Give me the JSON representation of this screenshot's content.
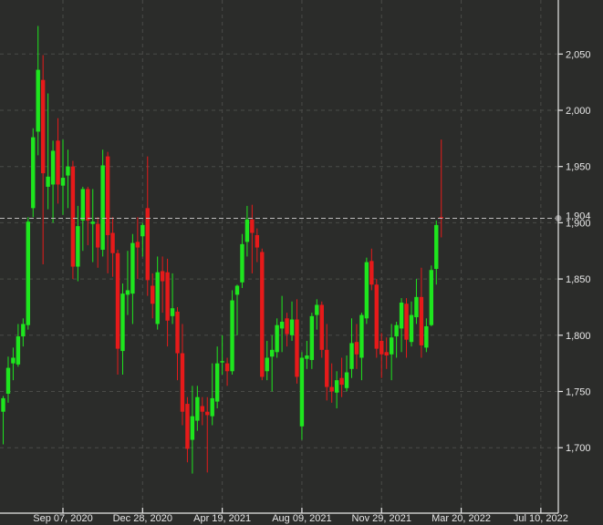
{
  "chart_data": {
    "type": "candlestick",
    "title": "",
    "xlabel": "",
    "ylabel": "",
    "interval": "weekly",
    "start_week": "2020-06-15",
    "ylim": [
      1640,
      2095
    ],
    "grid": true,
    "y_ticks": [
      1700,
      1750,
      1800,
      1850,
      1900,
      1950,
      2000,
      2050
    ],
    "y_tick_labels": [
      "1,700",
      "1,750",
      "1,800",
      "1,850",
      "1,900",
      "1,950",
      "2,000",
      "2,050"
    ],
    "x_ticks_week_index": [
      12,
      28,
      44,
      60,
      76,
      92,
      108
    ],
    "x_tick_labels": [
      "Sep 07, 2020",
      "Dec 28, 2020",
      "Apr 19, 2021",
      "Aug 09, 2021",
      "Nov 29, 2021",
      "Mar 20, 2022",
      "Jul 10, 2022"
    ],
    "last_price": 1904,
    "last_price_label": "1,904",
    "colors": {
      "up": "#1ee61e",
      "down": "#e61a1a",
      "background": "#2b2c2a",
      "last_price_line": "#bdbdbd"
    },
    "ohlc": [
      [
        1732,
        1746,
        1703,
        1744
      ],
      [
        1748,
        1781,
        1740,
        1771
      ],
      [
        1775,
        1789,
        1760,
        1780
      ],
      [
        1774,
        1810,
        1772,
        1799
      ],
      [
        1799,
        1815,
        1790,
        1810
      ],
      [
        1809,
        1905,
        1805,
        1901
      ],
      [
        1913,
        1984,
        1905,
        1976
      ],
      [
        1981,
        2075,
        1960,
        2036
      ],
      [
        2027,
        2049,
        1863,
        1944
      ],
      [
        1932,
        2015,
        1912,
        1941
      ],
      [
        1934,
        1973,
        1900,
        1964
      ],
      [
        1973,
        1993,
        1917,
        1934
      ],
      [
        1933,
        1974,
        1907,
        1940
      ],
      [
        1942,
        1965,
        1913,
        1950
      ],
      [
        1950,
        1955,
        1850,
        1861
      ],
      [
        1861,
        1915,
        1848,
        1897
      ],
      [
        1902,
        1932,
        1875,
        1930
      ],
      [
        1930,
        1932,
        1880,
        1902
      ],
      [
        1899,
        1930,
        1865,
        1901
      ],
      [
        1899,
        1905,
        1860,
        1878
      ],
      [
        1876,
        1965,
        1870,
        1951
      ],
      [
        1959,
        1963,
        1855,
        1889
      ],
      [
        1891,
        1905,
        1852,
        1873
      ],
      [
        1873,
        1876,
        1765,
        1788
      ],
      [
        1786,
        1846,
        1765,
        1837
      ],
      [
        1836,
        1875,
        1818,
        1840
      ],
      [
        1837,
        1890,
        1810,
        1882
      ],
      [
        1883,
        1905,
        1850,
        1878
      ],
      [
        1888,
        1900,
        1870,
        1898
      ],
      [
        1913,
        1959,
        1835,
        1849
      ],
      [
        1844,
        1855,
        1815,
        1828
      ],
      [
        1810,
        1870,
        1805,
        1856
      ],
      [
        1857,
        1870,
        1820,
        1848
      ],
      [
        1856,
        1868,
        1790,
        1813
      ],
      [
        1817,
        1855,
        1810,
        1824
      ],
      [
        1821,
        1825,
        1760,
        1784
      ],
      [
        1784,
        1810,
        1720,
        1732
      ],
      [
        1739,
        1745,
        1687,
        1699
      ],
      [
        1707,
        1755,
        1677,
        1728
      ],
      [
        1724,
        1755,
        1715,
        1745
      ],
      [
        1737,
        1745,
        1720,
        1732
      ],
      [
        1732,
        1745,
        1678,
        1729
      ],
      [
        1728,
        1775,
        1720,
        1744
      ],
      [
        1741,
        1790,
        1735,
        1775
      ],
      [
        1776,
        1800,
        1765,
        1777
      ],
      [
        1775,
        1780,
        1755,
        1768
      ],
      [
        1768,
        1840,
        1765,
        1831
      ],
      [
        1836,
        1845,
        1800,
        1844
      ],
      [
        1847,
        1890,
        1842,
        1881
      ],
      [
        1883,
        1915,
        1870,
        1903
      ],
      [
        1903,
        1916,
        1855,
        1891
      ],
      [
        1889,
        1895,
        1865,
        1878
      ],
      [
        1874,
        1877,
        1760,
        1763
      ],
      [
        1768,
        1795,
        1760,
        1780
      ],
      [
        1781,
        1800,
        1750,
        1787
      ],
      [
        1785,
        1815,
        1780,
        1809
      ],
      [
        1806,
        1835,
        1785,
        1812
      ],
      [
        1815,
        1820,
        1790,
        1801
      ],
      [
        1800,
        1830,
        1795,
        1814
      ],
      [
        1814,
        1832,
        1757,
        1763
      ],
      [
        1719,
        1785,
        1707,
        1780
      ],
      [
        1779,
        1795,
        1770,
        1782
      ],
      [
        1778,
        1820,
        1770,
        1817
      ],
      [
        1818,
        1832,
        1805,
        1827
      ],
      [
        1827,
        1830,
        1780,
        1787
      ],
      [
        1787,
        1810,
        1742,
        1754
      ],
      [
        1754,
        1775,
        1740,
        1750
      ],
      [
        1749,
        1768,
        1735,
        1760
      ],
      [
        1762,
        1780,
        1745,
        1756
      ],
      [
        1753,
        1782,
        1750,
        1767
      ],
      [
        1770,
        1815,
        1762,
        1793
      ],
      [
        1794,
        1810,
        1770,
        1783
      ],
      [
        1780,
        1820,
        1760,
        1818
      ],
      [
        1815,
        1869,
        1810,
        1865
      ],
      [
        1866,
        1877,
        1840,
        1845
      ],
      [
        1845,
        1850,
        1780,
        1788
      ],
      [
        1795,
        1802,
        1762,
        1783
      ],
      [
        1785,
        1798,
        1770,
        1782
      ],
      [
        1783,
        1810,
        1760,
        1798
      ],
      [
        1799,
        1812,
        1780,
        1809
      ],
      [
        1806,
        1833,
        1785,
        1829
      ],
      [
        1828,
        1833,
        1780,
        1796
      ],
      [
        1794,
        1830,
        1790,
        1818
      ],
      [
        1816,
        1850,
        1810,
        1834
      ],
      [
        1834,
        1860,
        1780,
        1791
      ],
      [
        1789,
        1815,
        1785,
        1808
      ],
      [
        1809,
        1862,
        1808,
        1858
      ],
      [
        1859,
        1902,
        1845,
        1898
      ],
      [
        1905,
        1974,
        1887,
        1904
      ]
    ]
  }
}
